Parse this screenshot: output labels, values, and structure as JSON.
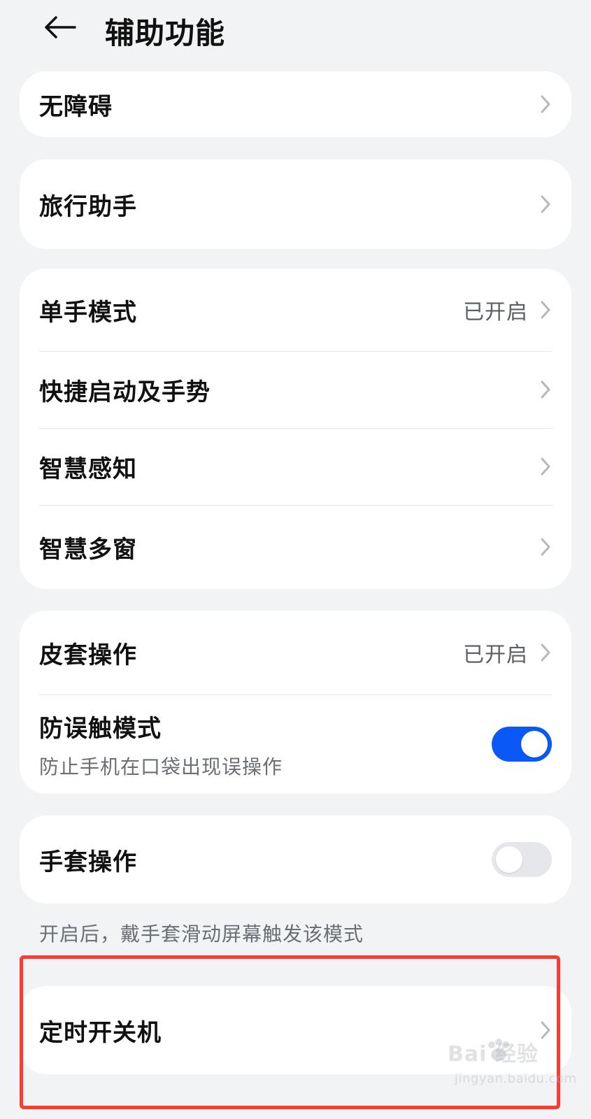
{
  "header": {
    "title": "辅助功能",
    "back_icon": "back-arrow-icon"
  },
  "sections": [
    {
      "items": [
        {
          "label": "无障碍",
          "icon": "chevron-right-icon"
        }
      ]
    },
    {
      "items": [
        {
          "label": "旅行助手",
          "icon": "chevron-right-icon"
        }
      ]
    },
    {
      "items": [
        {
          "label": "单手模式",
          "status": "已开启",
          "icon": "chevron-right-icon"
        },
        {
          "label": "快捷启动及手势",
          "icon": "chevron-right-icon"
        },
        {
          "label": "智慧感知",
          "icon": "chevron-right-icon"
        },
        {
          "label": "智慧多窗",
          "icon": "chevron-right-icon"
        }
      ]
    },
    {
      "items": [
        {
          "label": "皮套操作",
          "status": "已开启",
          "icon": "chevron-right-icon"
        },
        {
          "label": "防误触模式",
          "subtitle": "防止手机在口袋出现误操作",
          "toggle": true
        }
      ]
    },
    {
      "items": [
        {
          "label": "手套操作",
          "toggle": false
        }
      ],
      "caption": "开启后，戴手套滑动屏幕触发该模式"
    },
    {
      "items": [
        {
          "label": "定时开关机",
          "icon": "chevron-right-icon"
        }
      ]
    }
  ],
  "watermark": {
    "main": "Bai 经验",
    "sub": "jingyan.baidu.com"
  },
  "colors": {
    "page_background": "#f1f3f5",
    "card_background": "#ffffff",
    "toggle_on": "#0a59f7",
    "toggle_off": "#e5e7ea",
    "highlight": "#ff3b30"
  }
}
